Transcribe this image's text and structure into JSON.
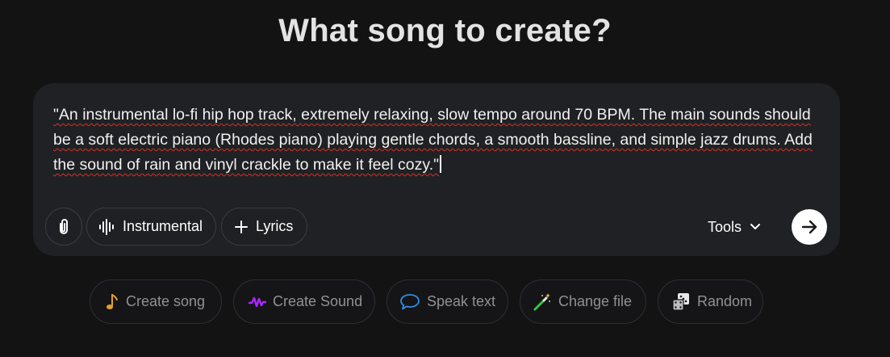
{
  "header": {
    "title": "What song to create?"
  },
  "composer": {
    "prompt_text": "\"An instrumental lo-fi hip hop track, extremely relaxing, slow tempo around 70 BPM. The main sounds should be a soft electric piano (Rhodes piano) playing gentle chords, a smooth bassline, and simple jazz drums. Add the sound of rain and vinyl crackle to make it feel cozy.\"",
    "attach_icon": "paperclip-icon",
    "instrumental": {
      "label": "Instrumental",
      "icon": "audio-waveform-icon"
    },
    "lyrics": {
      "label": "Lyrics",
      "icon": "plus-icon"
    },
    "tools": {
      "label": "Tools",
      "icon": "chevron-down-icon"
    },
    "send_icon": "arrow-right-icon"
  },
  "suggestions": [
    {
      "label": "Create song",
      "icon": "music-note-icon",
      "color": "#e0a030"
    },
    {
      "label": "Create Sound",
      "icon": "soundwave-icon",
      "color": "#b026ff"
    },
    {
      "label": "Speak text",
      "icon": "speech-bubble-icon",
      "color": "#2f8de4"
    },
    {
      "label": "Change file",
      "icon": "magic-wand-icon",
      "color": "#36c24a"
    },
    {
      "label": "Random",
      "icon": "dice-icon",
      "color": "#e8e8e8"
    }
  ],
  "colors": {
    "background": "#131314",
    "composer_bg": "#202124",
    "spellcheck_underline": "#d93025"
  }
}
